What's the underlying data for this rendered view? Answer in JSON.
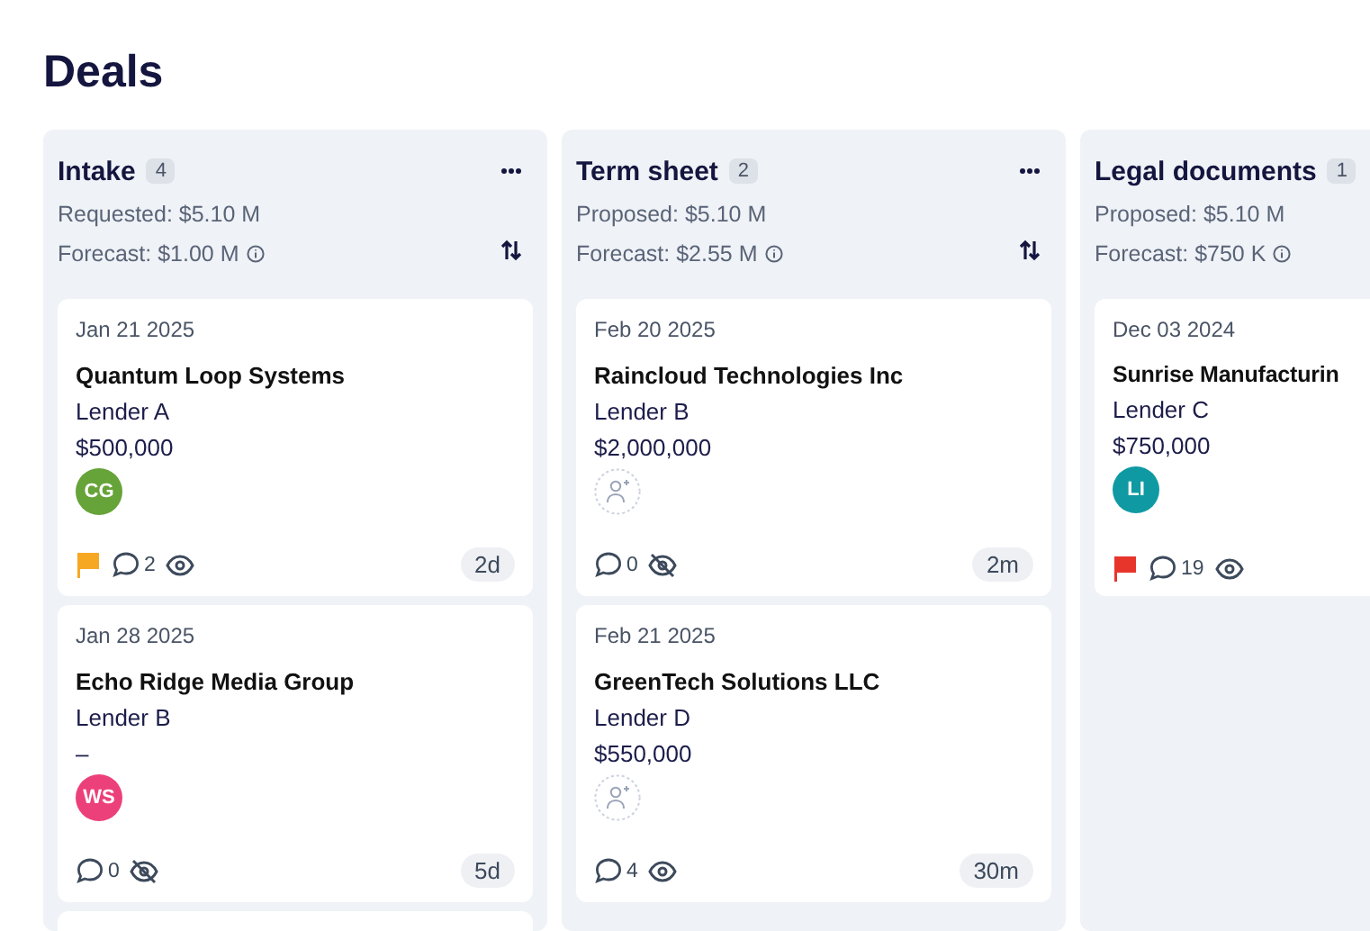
{
  "page": {
    "title": "Deals"
  },
  "columns": [
    {
      "title": "Intake",
      "count": "4",
      "line_1": "Requested: $5.10 M",
      "line_2": "Forecast: $1.00 M",
      "actions": true,
      "cards": [
        {
          "kind": "deal",
          "date": "Jan 21 2025",
          "company": "Quantum Loop Systems",
          "lender": "Lender A",
          "amount": "$500,000",
          "avatar": {
            "initials": "CG",
            "color": "#66a338"
          },
          "flag": {
            "color": "#f7a823"
          },
          "comments": "2",
          "watching": true,
          "age": "2d"
        },
        {
          "kind": "deal",
          "date": "Jan 28 2025",
          "company": "Echo Ridge Media Group",
          "lender": "Lender B",
          "amount": "–",
          "avatar": {
            "initials": "WS",
            "color": "#ec407a"
          },
          "comments": "0",
          "watching": false,
          "age": "5d"
        },
        {
          "kind": "cut"
        }
      ]
    },
    {
      "title": "Term sheet",
      "count": "2",
      "line_1": "Proposed: $5.10 M",
      "line_2": "Forecast: $2.55 M",
      "actions": true,
      "cards": [
        {
          "kind": "deal",
          "date": "Feb 20 2025",
          "company": "Raincloud Technologies Inc",
          "lender": "Lender B",
          "amount": "$2,000,000",
          "comments": "0",
          "watching": false,
          "age": "2m"
        },
        {
          "kind": "deal",
          "date": "Feb 21 2025",
          "company": "GreenTech Solutions LLC",
          "lender": "Lender D",
          "amount": "$550,000",
          "comments": "4",
          "watching": true,
          "age": "30m"
        }
      ]
    },
    {
      "title": "Legal documents",
      "count": "1",
      "line_1": "Proposed: $5.10 M",
      "line_2": "Forecast: $750 K",
      "actions": false,
      "cards": [
        {
          "kind": "deal",
          "date": "Dec 03 2024",
          "company": "Sunrise Manufacturin",
          "lender": "Lender C",
          "amount": "$750,000",
          "avatar": {
            "initials": "LI",
            "color": "#0f9aa3"
          },
          "flag": {
            "color": "#e8352b"
          },
          "comments": "19",
          "watching": true
        }
      ]
    }
  ]
}
